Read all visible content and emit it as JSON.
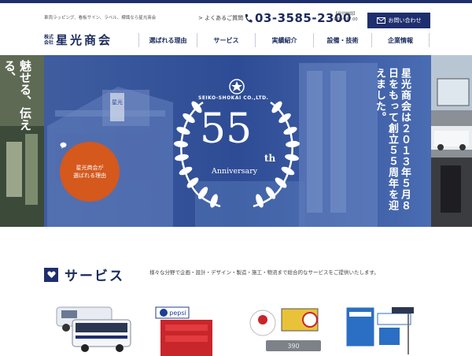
{
  "header": {
    "tagline": "車両ラッピング、看板サイン、ラベル、標識なら星光商会",
    "logo_small": "株式会社",
    "logo_main": "星光商会",
    "faq_label": "> よくあるご質問",
    "phone": "03-3585-2300",
    "hours_label": "【受付時間】",
    "hours_time": "9:00～17:00",
    "contact_label": "お問い合わせ"
  },
  "nav": [
    {
      "label": "選ばれる理由"
    },
    {
      "label": "サービス"
    },
    {
      "label": "実績紹介"
    },
    {
      "label": "設備・技術"
    },
    {
      "label": "企業情報"
    }
  ],
  "hero": {
    "left_vtext": "魅せる、伝える、",
    "seal_company": "SEIKO-SHOKAI CO.,LTD.",
    "big_number": "55",
    "ordinal": "th",
    "anniversary": "Anniversary",
    "announcement": "星光商会は２０１３年５月８日をもって創立５５周年を迎えました。",
    "badge_line1": "星光商会が",
    "badge_line2": "選ばれる理由",
    "building_sign": "星光",
    "bus_label": "pepsi",
    "sign_number": "390"
  },
  "service": {
    "title": "サービス",
    "description": "様々な分野で企画・設計・デザイン・製造・施工・物流まで総合的なサービスをご提供いたします。"
  },
  "colors": {
    "navy": "#1e2f6e",
    "accent_orange": "#d5581d",
    "hero_blue": "#3e5ea5"
  }
}
